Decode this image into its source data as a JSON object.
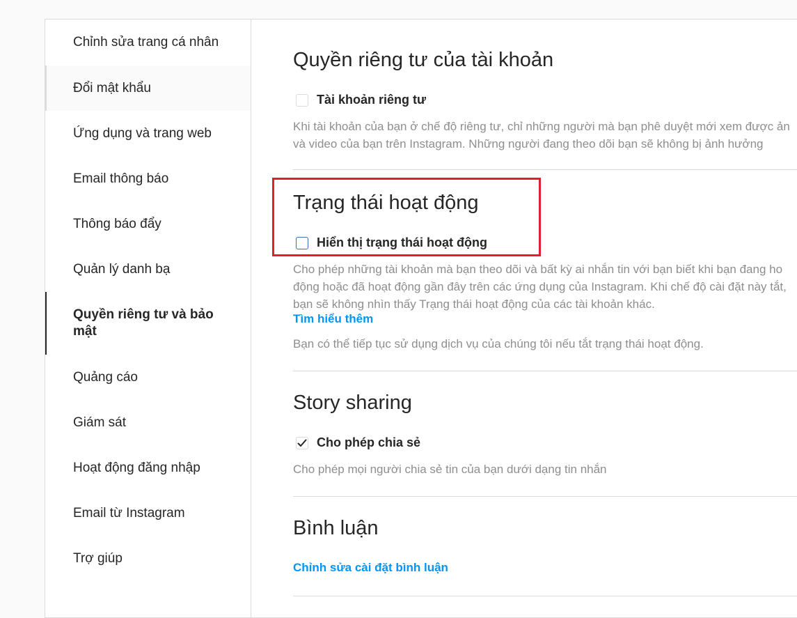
{
  "sidebar": {
    "items": [
      {
        "label": "Chỉnh sửa trang cá nhân"
      },
      {
        "label": "Đổi mật khẩu"
      },
      {
        "label": "Ứng dụng và trang web"
      },
      {
        "label": "Email thông báo"
      },
      {
        "label": "Thông báo đẩy"
      },
      {
        "label": "Quản lý danh bạ"
      },
      {
        "label": "Quyền riêng tư và bảo mật"
      },
      {
        "label": "Quảng cáo"
      },
      {
        "label": "Giám sát"
      },
      {
        "label": "Hoạt động đăng nhập"
      },
      {
        "label": "Email từ Instagram"
      },
      {
        "label": "Trợ giúp"
      }
    ],
    "active_index": 6,
    "hover_index": 1
  },
  "account_privacy": {
    "title": "Quyền riêng tư của tài khoản",
    "checkbox_label": "Tài khoản riêng tư",
    "checked": false,
    "desc_line1": "Khi tài khoản của bạn ở chế độ riêng tư, chỉ những người mà bạn phê duyệt mới xem được ản",
    "desc_line2": "và video của bạn trên Instagram. Những người đang theo dõi bạn sẽ không bị ảnh hưởng"
  },
  "activity_status": {
    "title": "Trạng thái hoạt động",
    "checkbox_label": "Hiển thị trạng thái hoạt động",
    "checked": false,
    "desc_line1": "Cho phép những tài khoản mà bạn theo dõi và bất kỳ ai nhắn tin với bạn biết khi bạn đang ho",
    "desc_line2": "động hoặc đã hoạt động gần đây trên các ứng dụng của Instagram. Khi chế độ cài đặt này tắt,",
    "desc_line3": "bạn sẽ không nhìn thấy Trạng thái hoạt động của các tài khoản khác.",
    "learn_more": "Tìm hiểu thêm",
    "note": "Bạn có thể tiếp tục sử dụng dịch vụ của chúng tôi nếu tắt trạng thái hoạt động."
  },
  "story_sharing": {
    "title": "Story sharing",
    "checkbox_label": "Cho phép chia sẻ",
    "checked": true,
    "desc": "Cho phép mọi người chia sẻ tin của bạn dưới dạng tin nhắn"
  },
  "comments": {
    "title": "Bình luận",
    "edit_link": "Chỉnh sửa cài đặt bình luận"
  },
  "colors": {
    "link": "#0095f6",
    "highlight": "#e0202e",
    "border": "#dbdbdb",
    "muted_text": "#8e8e8e"
  }
}
